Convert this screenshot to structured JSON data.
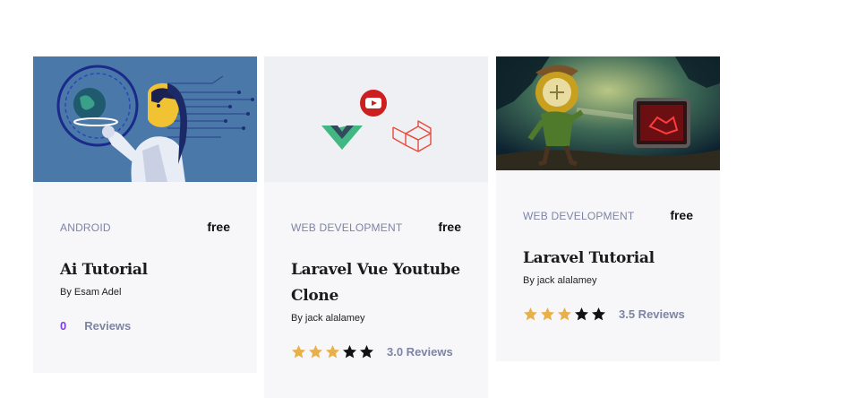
{
  "courses": [
    {
      "category": "ANDROID",
      "price": "free",
      "title": "Ai Tutorial",
      "author": "By Esam Adel",
      "rating_count": "0",
      "reviews_label": "Reviews",
      "image_icon": "robot-globe-illustration"
    },
    {
      "category": "WEB DEVELOPMENT",
      "price": "free",
      "title": "Laravel Vue Youtube Clone",
      "author": "By jack alalamey",
      "rating": 3,
      "stars_total": 5,
      "reviews_label": "3.0 Reviews",
      "image_icon": "vue-youtube-laravel-logos"
    },
    {
      "category": "WEB DEVELOPMENT",
      "price": "free",
      "title": "Laravel Tutorial",
      "author": "By jack alalamey",
      "rating": 3,
      "stars_total": 5,
      "reviews_label": "3.5 Reviews",
      "image_icon": "cave-explorer-illustration"
    }
  ],
  "colors": {
    "star_filled": "#e8b04b",
    "star_empty": "#111111",
    "card_bg": "#f7f7f9",
    "category": "#7e84a3",
    "count_accent": "#7b3fe4"
  }
}
